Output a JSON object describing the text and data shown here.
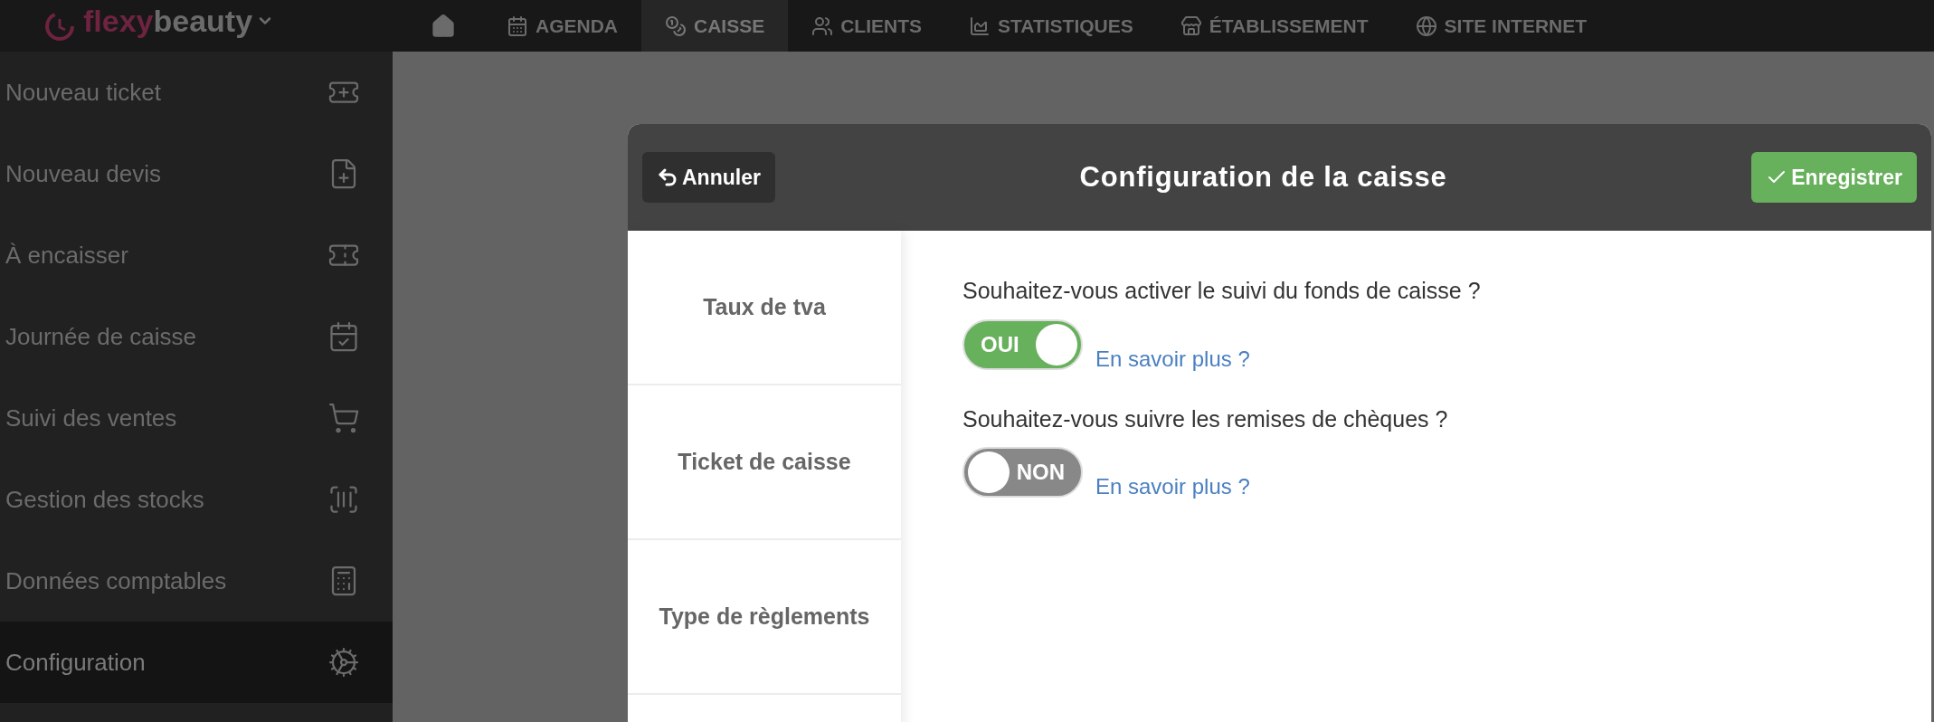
{
  "logo": {
    "part_1": "flexy",
    "part_2": "beauty"
  },
  "nav": [
    {
      "label": "AGENDA",
      "selected": false
    },
    {
      "label": "CAISSE",
      "selected": true
    },
    {
      "label": "CLIENTS",
      "selected": false
    },
    {
      "label": "STATISTIQUES",
      "selected": false
    },
    {
      "label": "ÉTABLISSEMENT",
      "selected": false
    },
    {
      "label": "SITE INTERNET",
      "selected": false
    }
  ],
  "sidebar": {
    "items": [
      {
        "label": "Nouveau ticket",
        "selected": false
      },
      {
        "label": "Nouveau devis",
        "selected": false
      },
      {
        "label": "À encaisser",
        "selected": false
      },
      {
        "label": "Journée de caisse",
        "selected": false
      },
      {
        "label": "Suivi des ventes",
        "selected": false
      },
      {
        "label": "Gestion des stocks",
        "selected": false
      },
      {
        "label": "Données comptables",
        "selected": false
      },
      {
        "label": "Configuration",
        "selected": true
      }
    ]
  },
  "modal": {
    "title": "Configuration de la caisse",
    "cancel_button": "Annuler",
    "save_button": "Enregistrer",
    "tabs": [
      {
        "label": "Taux de tva"
      },
      {
        "label": "Ticket de caisse"
      },
      {
        "label": "Type de règlements"
      }
    ],
    "settings": [
      {
        "question": "Souhaitez-vous activer le suivi du fonds de caisse ?",
        "on": true,
        "toggle_label": "OUI",
        "link": "En savoir plus ?"
      },
      {
        "question": "Souhaitez-vous suivre les remises de chèques ?",
        "on": false,
        "toggle_label": "NON",
        "link": "En savoir plus ?"
      }
    ]
  }
}
